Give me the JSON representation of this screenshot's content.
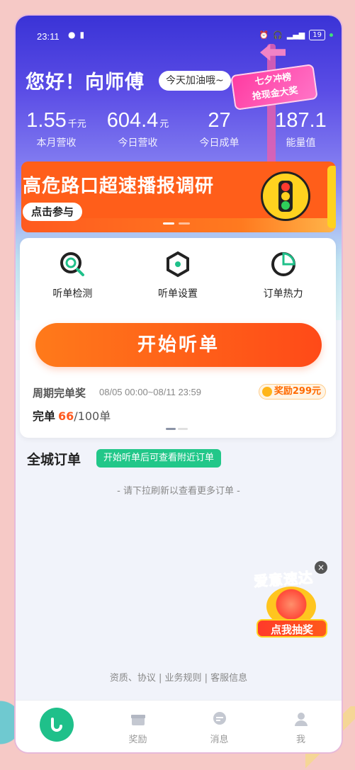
{
  "status_bar": {
    "time": "23:11",
    "battery": "19"
  },
  "header": {
    "greeting": "您好！向师傅",
    "cheer_pill": "今天加油哦~",
    "promo_sign_line1": "七夕冲榜",
    "promo_sign_line2": "抢现金大奖"
  },
  "stats": [
    {
      "value": "1.55",
      "unit": "千元",
      "label": "本月营收"
    },
    {
      "value": "604.4",
      "unit": "元",
      "label": "今日营收"
    },
    {
      "value": "27",
      "unit": "",
      "label": "今日成单"
    },
    {
      "value": "187.1",
      "unit": "",
      "label": "能量值"
    }
  ],
  "banner": {
    "title": "高危路口超速播报调研",
    "button": "点击参与",
    "pages": 2,
    "active_page": 0
  },
  "tools": [
    {
      "label": "听单检测",
      "icon": "listen-check-icon"
    },
    {
      "label": "听单设置",
      "icon": "listen-settings-icon"
    },
    {
      "label": "订单热力",
      "icon": "order-heat-icon"
    }
  ],
  "start_button": "开始听单",
  "bonus": {
    "title": "周期完单奖",
    "period": "08/05 00:00~08/11 23:59",
    "reward": "奖励299元",
    "complete_label": "完单",
    "complete_done": "66",
    "complete_total": "/100单"
  },
  "city_orders": {
    "title": "全城订单",
    "badge": "开始听单后可查看附近订单",
    "pull_hint": "- 请下拉刷新以查看更多订单 -"
  },
  "lottery": {
    "title": "爱意速达",
    "button": "点我抽奖",
    "close": "×"
  },
  "footer_links": "资质、协议 | 业务规则 | 客服信息",
  "tabs": [
    {
      "label": "",
      "icon": "home-icon"
    },
    {
      "label": "奖励",
      "icon": "gift-icon"
    },
    {
      "label": "消息",
      "icon": "message-icon"
    },
    {
      "label": "我",
      "icon": "profile-icon"
    }
  ],
  "colors": {
    "brand_green": "#1fc08a",
    "accent_orange": "#ff5a1f",
    "header_blue": "#3a33d6"
  }
}
